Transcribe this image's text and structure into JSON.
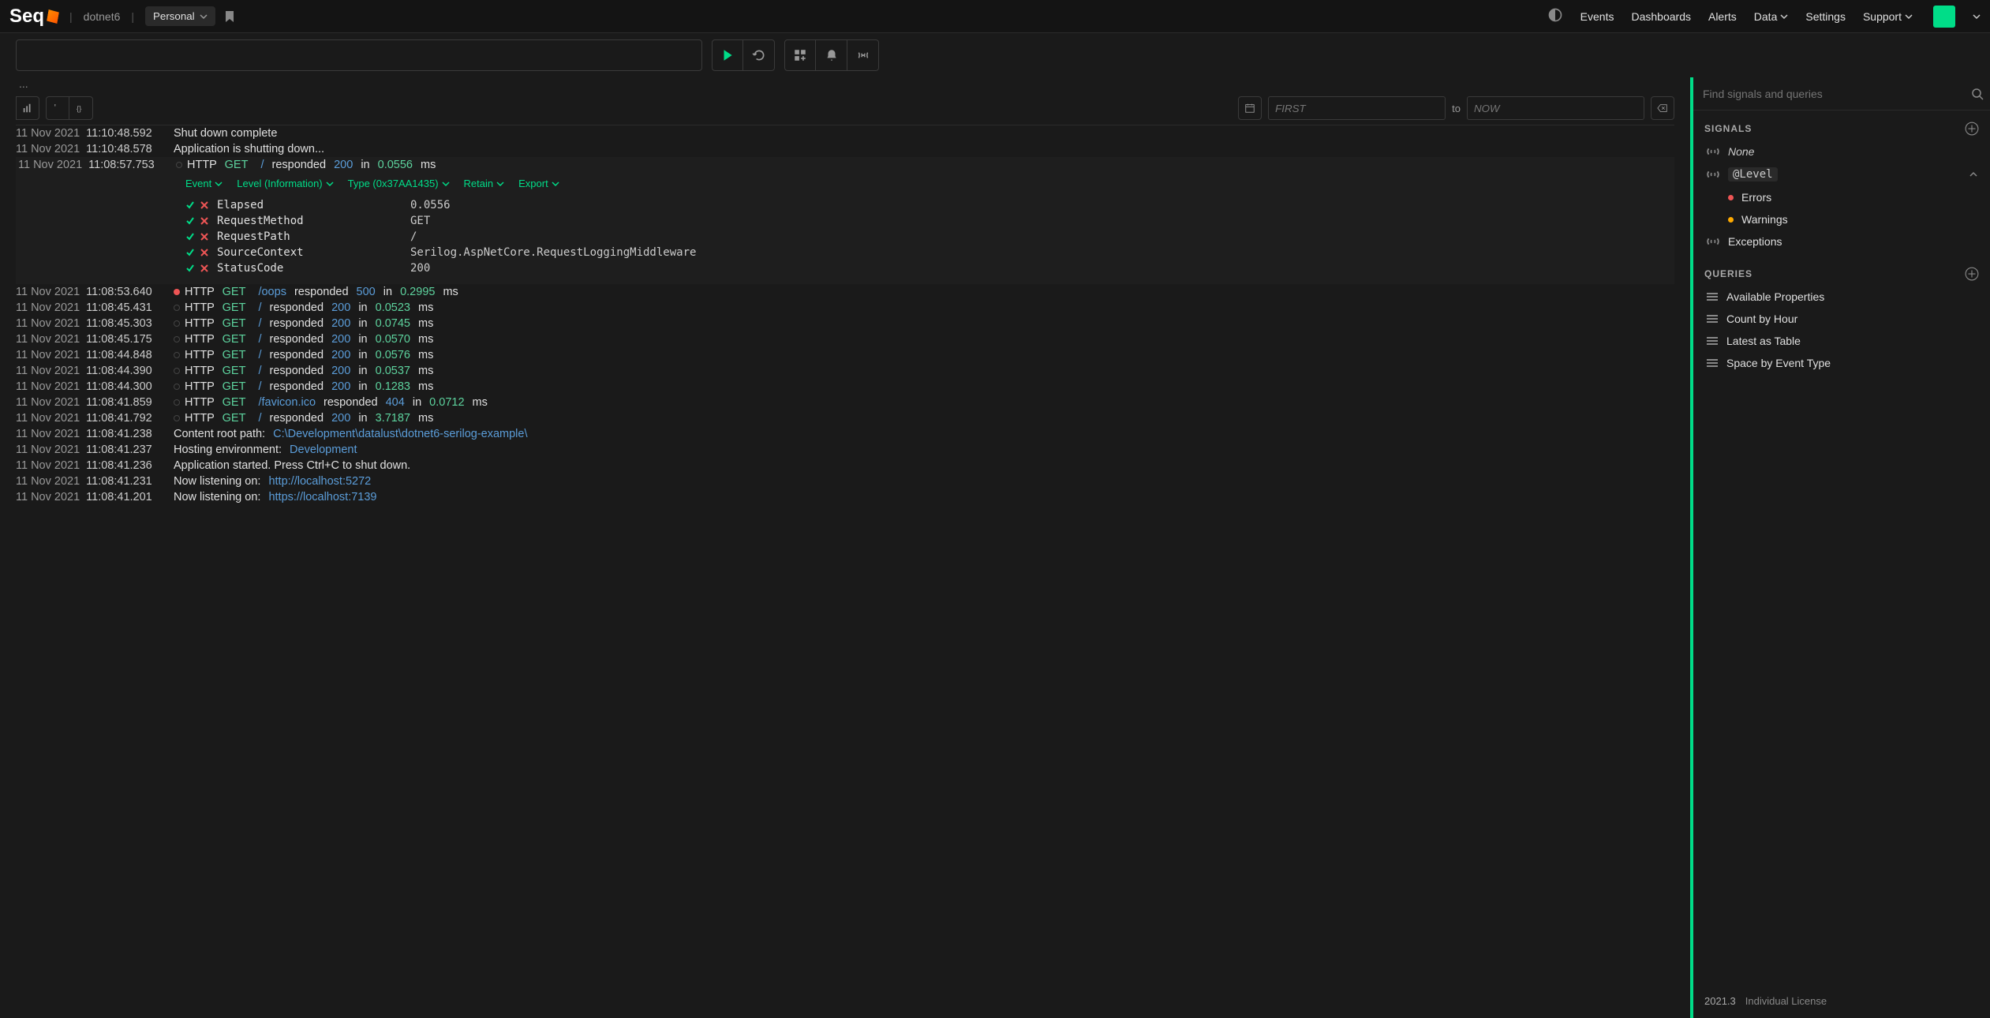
{
  "header": {
    "logo": "Seq",
    "project": "dotnet6",
    "workspace": "Personal",
    "nav": {
      "events": "Events",
      "dashboards": "Dashboards",
      "alerts": "Alerts",
      "data": "Data",
      "settings": "Settings",
      "support": "Support"
    }
  },
  "toolbar": {
    "search_value": "",
    "ellipsis": "..."
  },
  "time": {
    "from_placeholder": "FIRST",
    "to_label": "to",
    "to_placeholder": "NOW"
  },
  "expanded_menu": {
    "event": "Event",
    "level": "Level (Information)",
    "type": "Type (0x37AA1435)",
    "retain": "Retain",
    "export": "Export"
  },
  "expanded_props": [
    {
      "key": "Elapsed",
      "value": "0.0556"
    },
    {
      "key": "RequestMethod",
      "value": "GET"
    },
    {
      "key": "RequestPath",
      "value": "/"
    },
    {
      "key": "SourceContext",
      "value": "Serilog.AspNetCore.RequestLoggingMiddleware"
    },
    {
      "key": "StatusCode",
      "value": "200"
    }
  ],
  "events": [
    {
      "date": "11 Nov 2021",
      "time": "11:10:48.592",
      "kind": "plain",
      "text": "Shut down complete"
    },
    {
      "date": "11 Nov 2021",
      "time": "11:10:48.578",
      "kind": "plain",
      "text": "Application is shutting down..."
    },
    {
      "date": "11 Nov 2021",
      "time": "11:08:57.753",
      "kind": "http",
      "expanded": true,
      "method": "GET",
      "path": "/",
      "status": "200",
      "elapsed": "0.0556"
    },
    {
      "date": "11 Nov 2021",
      "time": "11:08:53.640",
      "kind": "http",
      "level": "error",
      "method": "GET",
      "path": "/oops",
      "status": "500",
      "elapsed": "0.2995"
    },
    {
      "date": "11 Nov 2021",
      "time": "11:08:45.431",
      "kind": "http",
      "method": "GET",
      "path": "/",
      "status": "200",
      "elapsed": "0.0523"
    },
    {
      "date": "11 Nov 2021",
      "time": "11:08:45.303",
      "kind": "http",
      "method": "GET",
      "path": "/",
      "status": "200",
      "elapsed": "0.0745"
    },
    {
      "date": "11 Nov 2021",
      "time": "11:08:45.175",
      "kind": "http",
      "method": "GET",
      "path": "/",
      "status": "200",
      "elapsed": "0.0570"
    },
    {
      "date": "11 Nov 2021",
      "time": "11:08:44.848",
      "kind": "http",
      "method": "GET",
      "path": "/",
      "status": "200",
      "elapsed": "0.0576"
    },
    {
      "date": "11 Nov 2021",
      "time": "11:08:44.390",
      "kind": "http",
      "method": "GET",
      "path": "/",
      "status": "200",
      "elapsed": "0.0537"
    },
    {
      "date": "11 Nov 2021",
      "time": "11:08:44.300",
      "kind": "http",
      "method": "GET",
      "path": "/",
      "status": "200",
      "elapsed": "0.1283"
    },
    {
      "date": "11 Nov 2021",
      "time": "11:08:41.859",
      "kind": "http",
      "method": "GET",
      "path": "/favicon.ico",
      "status": "404",
      "elapsed": "0.0712"
    },
    {
      "date": "11 Nov 2021",
      "time": "11:08:41.792",
      "kind": "http",
      "method": "GET",
      "path": "/",
      "status": "200",
      "elapsed": "3.7187"
    },
    {
      "date": "11 Nov 2021",
      "time": "11:08:41.238",
      "kind": "kv",
      "prefix": "Content root path: ",
      "value": "C:\\Development\\datalust\\dotnet6-serilog-example\\"
    },
    {
      "date": "11 Nov 2021",
      "time": "11:08:41.237",
      "kind": "kv",
      "prefix": "Hosting environment: ",
      "value": "Development"
    },
    {
      "date": "11 Nov 2021",
      "time": "11:08:41.236",
      "kind": "plain",
      "text": "Application started. Press Ctrl+C to shut down."
    },
    {
      "date": "11 Nov 2021",
      "time": "11:08:41.231",
      "kind": "kv",
      "prefix": "Now listening on: ",
      "value": "http://localhost:5272"
    },
    {
      "date": "11 Nov 2021",
      "time": "11:08:41.201",
      "kind": "kv",
      "prefix": "Now listening on: ",
      "value": "https://localhost:7139"
    }
  ],
  "sidebar": {
    "search_placeholder": "Find signals and queries",
    "signals_header": "SIGNALS",
    "queries_header": "QUERIES",
    "signals": {
      "none": "None",
      "level_group": "@Level",
      "errors": "Errors",
      "warnings": "Warnings",
      "exceptions": "Exceptions"
    },
    "queries": [
      "Available Properties",
      "Count by Hour",
      "Latest as Table",
      "Space by Event Type"
    ],
    "version": "2021.3",
    "license": "Individual License"
  }
}
